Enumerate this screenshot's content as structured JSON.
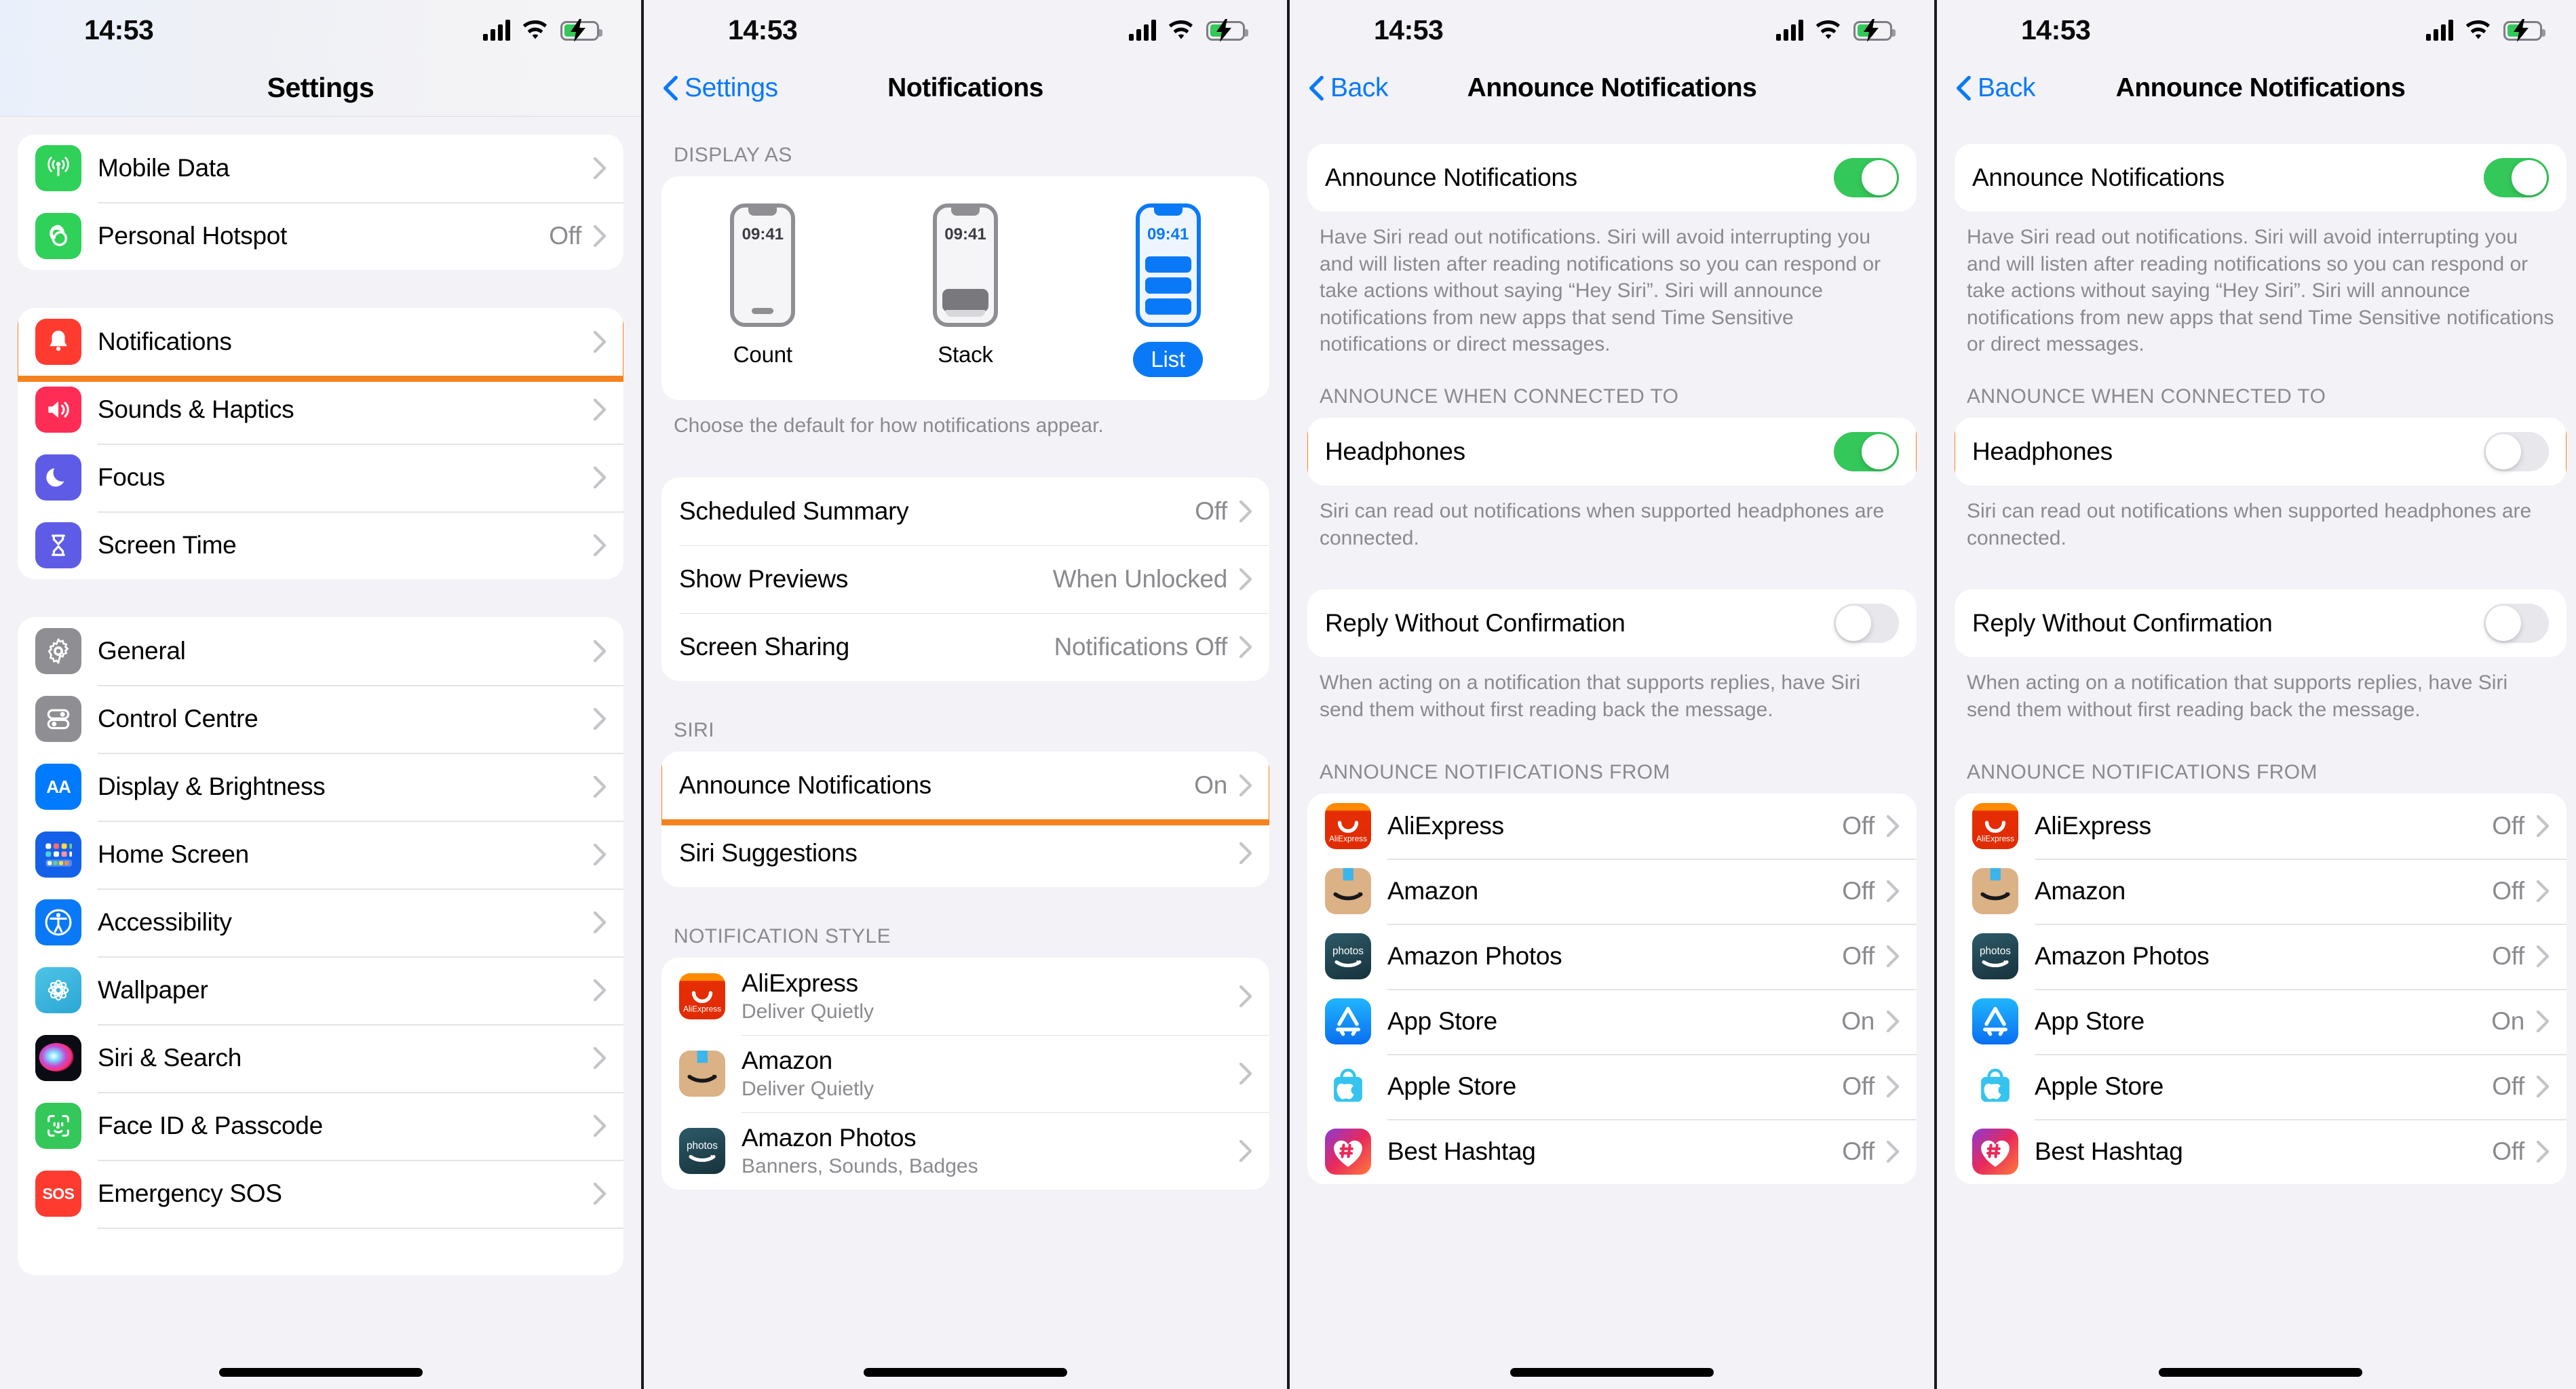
{
  "status_bar": {
    "time": "14:53",
    "icons": [
      "cellular-signal-icon",
      "wifi-icon",
      "battery-charging-icon"
    ]
  },
  "panel1": {
    "title": "Settings",
    "group_top": [
      {
        "label": "Mobile Data",
        "value": "",
        "icon": "mobile-data-icon"
      },
      {
        "label": "Personal Hotspot",
        "value": "Off",
        "icon": "personal-hotspot-icon"
      }
    ],
    "group_second": [
      {
        "label": "Notifications",
        "value": "",
        "icon": "notifications-icon",
        "highlighted": true
      },
      {
        "label": "Sounds & Haptics",
        "value": "",
        "icon": "sounds-haptics-icon"
      },
      {
        "label": "Focus",
        "value": "",
        "icon": "focus-icon"
      },
      {
        "label": "Screen Time",
        "value": "",
        "icon": "screen-time-icon"
      }
    ],
    "group_third": [
      {
        "label": "General",
        "value": "",
        "icon": "general-icon"
      },
      {
        "label": "Control Centre",
        "value": "",
        "icon": "control-centre-icon"
      },
      {
        "label": "Display & Brightness",
        "value": "",
        "icon": "display-brightness-icon"
      },
      {
        "label": "Home Screen",
        "value": "",
        "icon": "home-screen-icon"
      },
      {
        "label": "Accessibility",
        "value": "",
        "icon": "accessibility-icon"
      },
      {
        "label": "Wallpaper",
        "value": "",
        "icon": "wallpaper-icon"
      },
      {
        "label": "Siri & Search",
        "value": "",
        "icon": "siri-search-icon"
      },
      {
        "label": "Face ID & Passcode",
        "value": "",
        "icon": "face-id-icon"
      },
      {
        "label": "Emergency SOS",
        "value": "",
        "icon": "emergency-sos-icon"
      }
    ]
  },
  "panel2": {
    "back_label": "Settings",
    "title": "Notifications",
    "display_as_header": "DISPLAY AS",
    "display_options": [
      {
        "label": "Count",
        "time": "09:41",
        "selected": false
      },
      {
        "label": "Stack",
        "time": "09:41",
        "selected": false
      },
      {
        "label": "List",
        "time": "09:41",
        "selected": true
      }
    ],
    "display_as_footer": "Choose the default for how notifications appear.",
    "settings_rows": [
      {
        "label": "Scheduled Summary",
        "value": "Off"
      },
      {
        "label": "Show Previews",
        "value": "When Unlocked"
      },
      {
        "label": "Screen Sharing",
        "value": "Notifications Off"
      }
    ],
    "siri_header": "SIRI",
    "siri_rows": [
      {
        "label": "Announce Notifications",
        "value": "On",
        "highlighted": true
      },
      {
        "label": "Siri Suggestions",
        "value": ""
      }
    ],
    "notification_style_header": "NOTIFICATION STYLE",
    "apps": [
      {
        "name": "AliExpress",
        "sub": "Deliver Quietly",
        "icon": "aliexpress-icon"
      },
      {
        "name": "Amazon",
        "sub": "Deliver Quietly",
        "icon": "amazon-icon"
      },
      {
        "name": "Amazon Photos",
        "sub": "Banners, Sounds, Badges",
        "icon": "amazon-photos-icon"
      }
    ]
  },
  "panel3": {
    "back_label": "Back",
    "title": "Announce Notifications",
    "main_toggle": {
      "label": "Announce Notifications",
      "state": "on"
    },
    "main_footer": "Have Siri read out notifications. Siri will avoid interrupting you and will listen after reading notifications so you can respond or take actions without saying “Hey Siri”. Siri will announce notifications from new apps that send Time Sensitive notifications or direct messages.",
    "connected_header": "ANNOUNCE WHEN CONNECTED TO",
    "headphones": {
      "label": "Headphones",
      "state": "on",
      "highlighted": true
    },
    "headphones_footer": "Siri can read out notifications when supported headphones are connected.",
    "reply_toggle": {
      "label": "Reply Without Confirmation",
      "state": "off"
    },
    "reply_footer": "When acting on a notification that supports replies, have Siri send them without first reading back the message.",
    "from_header": "ANNOUNCE NOTIFICATIONS FROM",
    "apps": [
      {
        "name": "AliExpress",
        "value": "Off",
        "icon": "aliexpress-icon"
      },
      {
        "name": "Amazon",
        "value": "Off",
        "icon": "amazon-icon"
      },
      {
        "name": "Amazon Photos",
        "value": "Off",
        "icon": "amazon-photos-icon"
      },
      {
        "name": "App Store",
        "value": "On",
        "icon": "app-store-icon"
      },
      {
        "name": "Apple Store",
        "value": "Off",
        "icon": "apple-store-icon"
      },
      {
        "name": "Best Hashtag",
        "value": "Off",
        "icon": "best-hashtag-icon"
      }
    ]
  },
  "panel4": {
    "back_label": "Back",
    "title": "Announce Notifications",
    "main_toggle": {
      "label": "Announce Notifications",
      "state": "on"
    },
    "main_footer": "Have Siri read out notifications. Siri will avoid interrupting you and will listen after reading notifications so you can respond or take actions without saying “Hey Siri”. Siri will announce notifications from new apps that send Time Sensitive notifications or direct messages.",
    "connected_header": "ANNOUNCE WHEN CONNECTED TO",
    "headphones": {
      "label": "Headphones",
      "state": "off",
      "highlighted": true
    },
    "headphones_footer": "Siri can read out notifications when supported headphones are connected.",
    "reply_toggle": {
      "label": "Reply Without Confirmation",
      "state": "off"
    },
    "reply_footer": "When acting on a notification that supports replies, have Siri send them without first reading back the message.",
    "from_header": "ANNOUNCE NOTIFICATIONS FROM",
    "apps": [
      {
        "name": "AliExpress",
        "value": "Off",
        "icon": "aliexpress-icon"
      },
      {
        "name": "Amazon",
        "value": "Off",
        "icon": "amazon-icon"
      },
      {
        "name": "Amazon Photos",
        "value": "Off",
        "icon": "amazon-photos-icon"
      },
      {
        "name": "App Store",
        "value": "On",
        "icon": "app-store-icon"
      },
      {
        "name": "Apple Store",
        "value": "Off",
        "icon": "apple-store-icon"
      },
      {
        "name": "Best Hashtag",
        "value": "Off",
        "icon": "best-hashtag-icon"
      }
    ]
  },
  "colors": {
    "highlight": "#f58220",
    "accent_blue": "#0a79f7",
    "toggle_on": "#34c759",
    "page_bg": "#f2f2f7"
  }
}
